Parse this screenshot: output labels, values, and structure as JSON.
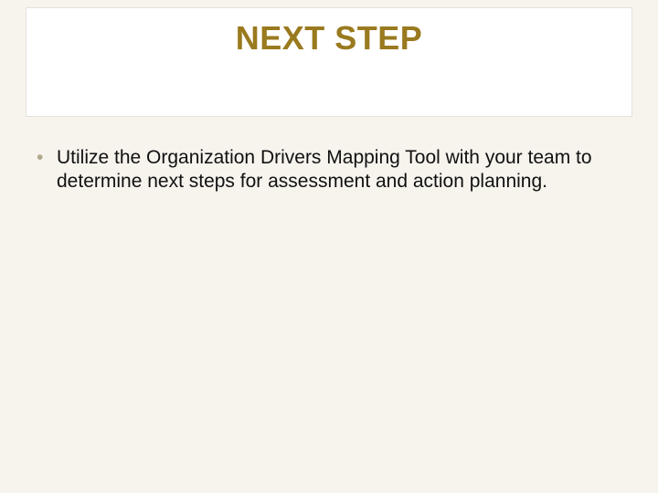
{
  "slide": {
    "title": "NEXT STEP",
    "bullets": [
      "Utilize the Organization Drivers Mapping Tool with your team to determine next steps for assessment and action planning."
    ]
  }
}
